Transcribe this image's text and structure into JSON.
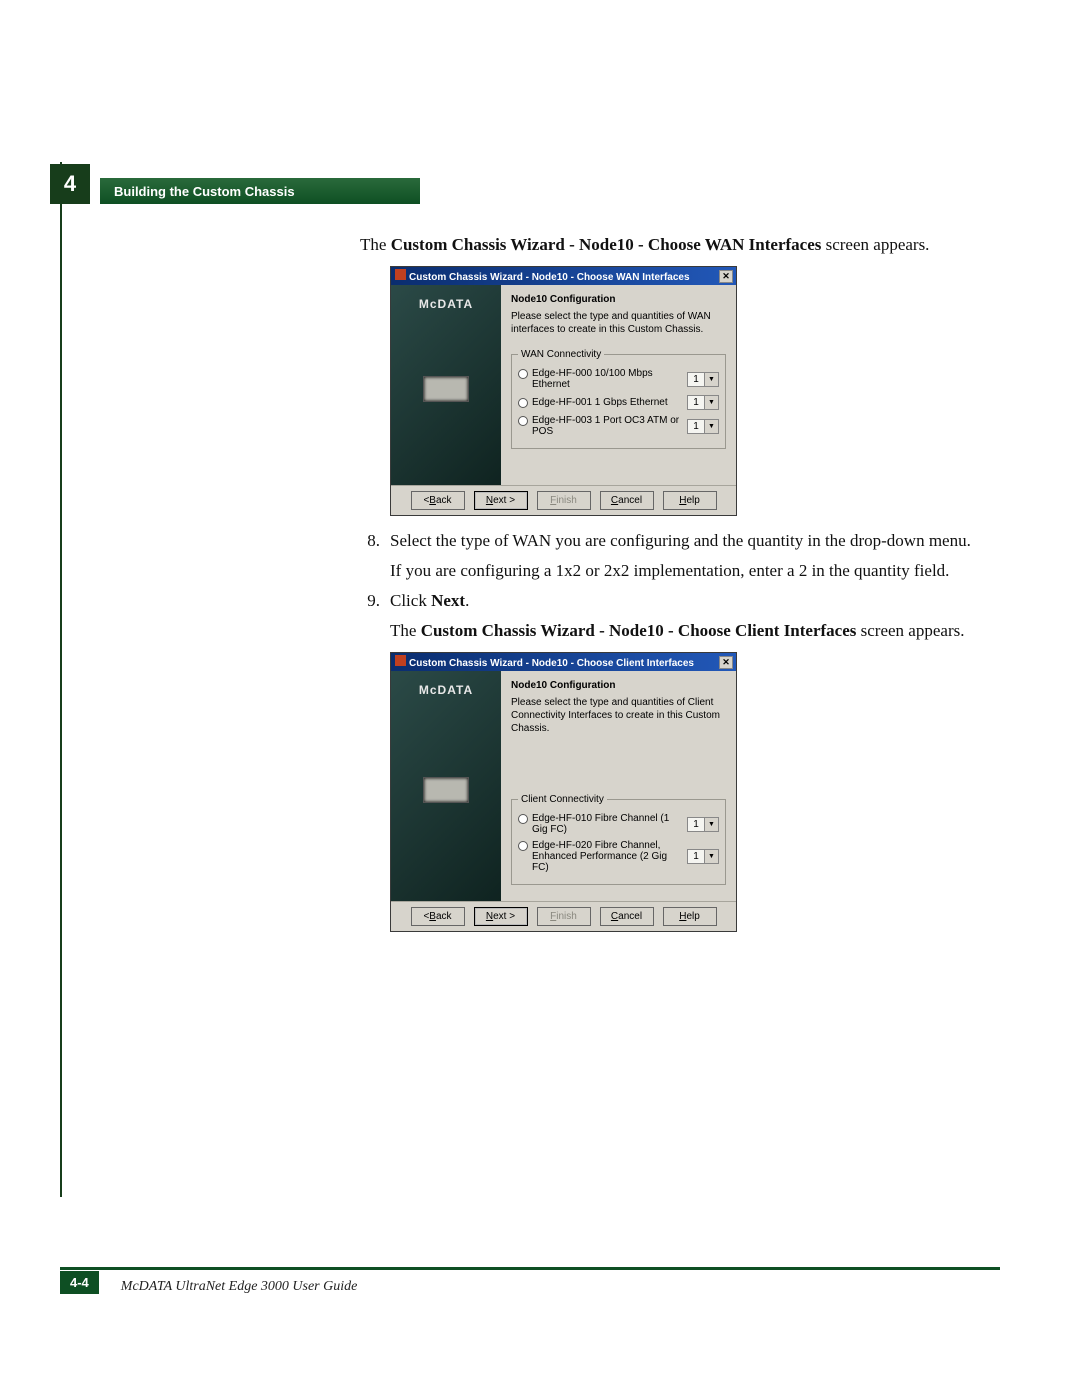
{
  "chapter_number": "4",
  "section_title": "Building the Custom Chassis",
  "intro": {
    "pre": "The ",
    "bold": "Custom Chassis Wizard - Node10 - Choose WAN Interfaces",
    "post": " screen appears."
  },
  "wizard1": {
    "title": "Custom Chassis Wizard - Node10 - Choose WAN Interfaces",
    "logo": "McDATA",
    "heading": "Node10 Configuration",
    "instructions": "Please select the type and quantities of WAN interfaces to create in this Custom Chassis.",
    "fieldset_label": "WAN Connectivity",
    "options": [
      {
        "label": "Edge-HF-000  10/100 Mbps Ethernet",
        "qty": "1"
      },
      {
        "label": "Edge-HF-001  1 Gbps Ethernet",
        "qty": "1"
      },
      {
        "label": "Edge-HF-003  1 Port OC3 ATM or POS",
        "qty": "1"
      }
    ],
    "buttons": {
      "back": "< Back",
      "next": "Next >",
      "finish": "Finish",
      "cancel": "Cancel",
      "help": "Help"
    }
  },
  "step8": {
    "num": "8.",
    "text": "Select the type of WAN you are configuring and the quantity in the drop-down menu.",
    "note": "If you are configuring a 1x2 or 2x2 implementation, enter a 2 in the quantity field."
  },
  "step9": {
    "num": "9.",
    "pre": "Click ",
    "bold": "Next",
    "post": "."
  },
  "intro2": {
    "pre": "The ",
    "bold": "Custom Chassis Wizard - Node10 - Choose Client Interfaces",
    "post": " screen appears."
  },
  "wizard2": {
    "title": "Custom Chassis Wizard - Node10 - Choose Client Interfaces",
    "logo": "McDATA",
    "heading": "Node10 Configuration",
    "instructions": "Please select the type and quantities of Client Connectivity Interfaces to create in this Custom Chassis.",
    "fieldset_label": "Client Connectivity",
    "options": [
      {
        "label": "Edge-HF-010  Fibre Channel (1 Gig FC)",
        "qty": "1"
      },
      {
        "label": "Edge-HF-020  Fibre Channel, Enhanced Performance (2 Gig FC)",
        "qty": "1"
      }
    ],
    "buttons": {
      "back": "< Back",
      "next": "Next >",
      "finish": "Finish",
      "cancel": "Cancel",
      "help": "Help"
    }
  },
  "footer": {
    "page": "4-4",
    "doc": "McDATA UltraNet Edge 3000 User Guide"
  }
}
